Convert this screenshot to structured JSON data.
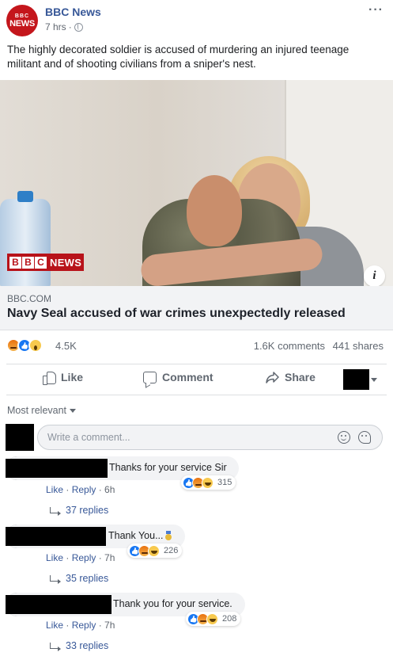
{
  "post": {
    "page_name": "BBC News",
    "time": "7 hrs",
    "time_separator": "·",
    "logo_top": "BBC",
    "logo_bottom": "NEWS",
    "text": "The highly decorated soldier is accused of murdering an injured teenage militant and of shooting civilians from a sniper's nest."
  },
  "image": {
    "watermark_letters": [
      "B",
      "B",
      "C"
    ],
    "watermark_news": "NEWS",
    "info": "i"
  },
  "link": {
    "domain": "BBC.COM",
    "title": "Navy Seal accused of war crimes unexpectedly released"
  },
  "stats": {
    "reactions": "4.5K",
    "comments": "1.6K comments",
    "shares": "441 shares"
  },
  "actions": {
    "like": "Like",
    "comment": "Comment",
    "share": "Share"
  },
  "sort": {
    "label": "Most relevant"
  },
  "composer": {
    "placeholder": "Write a comment..."
  },
  "comments": [
    {
      "text": "Thanks for your service Sir",
      "reaction_count": "315",
      "like": "Like",
      "reply": "Reply",
      "time": "6h",
      "replies": "37 replies"
    },
    {
      "text": "Thank You...",
      "reaction_count": "226",
      "like": "Like",
      "reply": "Reply",
      "time": "7h",
      "replies": "35 replies"
    },
    {
      "text": "Thank you for your service.",
      "reaction_count": "208",
      "like": "Like",
      "reply": "Reply",
      "time": "7h",
      "replies": "33 replies"
    }
  ],
  "colors": {
    "link_blue": "#385898",
    "meta_gray": "#606770",
    "bbc_red": "#c4161c",
    "like_blue": "#1877f2"
  }
}
